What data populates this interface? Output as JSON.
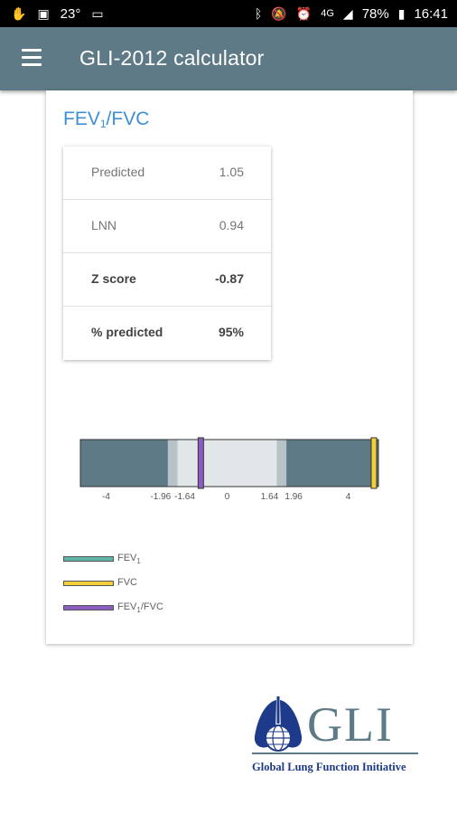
{
  "status_bar": {
    "temp": "23°",
    "battery": "78%",
    "time": "16:41",
    "network": "4G"
  },
  "app_bar": {
    "title": "GLI-2012 calculator"
  },
  "card": {
    "title_main": "FEV",
    "title_sub": "1",
    "title_rest": "/FVC",
    "rows": [
      {
        "label": "Predicted",
        "value": "1.05"
      },
      {
        "label": "LNN",
        "value": "0.94"
      },
      {
        "label": "Z score",
        "value": "-0.87"
      },
      {
        "label": "% predicted",
        "value": "95%"
      }
    ]
  },
  "chart_data": {
    "type": "bar",
    "x_ticks": [
      "-4",
      "-1.96",
      "-1.64",
      "0",
      "1.64",
      "1.96",
      "4"
    ],
    "x_range": [
      -4.85,
      5.0
    ],
    "markers": [
      {
        "name": "FEV1/FVC",
        "z": -0.87,
        "color": "#8b5cc4"
      },
      {
        "name": "FVC",
        "z": 4.85,
        "color": "#f5cf3a"
      }
    ],
    "colors": {
      "outer": "#5d7a86",
      "mid": "#b8c3c8",
      "inner": "#e1e6e8"
    }
  },
  "legend": [
    {
      "main": "FEV",
      "sub": "1",
      "rest": "",
      "color": "#5fb4a8"
    },
    {
      "main": "FVC",
      "sub": "",
      "rest": "",
      "color": "#f5cf3a"
    },
    {
      "main": "FEV",
      "sub": "1",
      "rest": "/FVC",
      "color": "#8b5cc4"
    }
  ],
  "logo": {
    "letters": "GLI",
    "tagline": "Global Lung Function Initiative"
  }
}
